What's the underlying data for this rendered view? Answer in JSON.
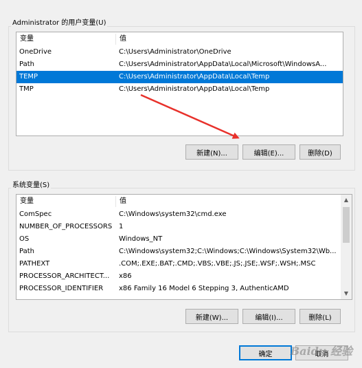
{
  "user_vars": {
    "group_title": "Administrator 的用户变量(U)",
    "headers": [
      "变量",
      "值"
    ],
    "rows": [
      {
        "name": "OneDrive",
        "value": "C:\\Users\\Administrator\\OneDrive"
      },
      {
        "name": "Path",
        "value": "C:\\Users\\Administrator\\AppData\\Local\\Microsoft\\WindowsA..."
      },
      {
        "name": "TEMP",
        "value": "C:\\Users\\Administrator\\AppData\\Local\\Temp"
      },
      {
        "name": "TMP",
        "value": "C:\\Users\\Administrator\\AppData\\Local\\Temp"
      }
    ],
    "selected_row": "TEMP",
    "buttons": {
      "new": "新建(N)...",
      "edit": "编辑(E)...",
      "delete": "删除(D)"
    }
  },
  "system_vars": {
    "group_title": "系统变量(S)",
    "headers": [
      "变量",
      "值"
    ],
    "rows": [
      {
        "name": "ComSpec",
        "value": "C:\\Windows\\system32\\cmd.exe"
      },
      {
        "name": "NUMBER_OF_PROCESSORS",
        "value": "1"
      },
      {
        "name": "OS",
        "value": "Windows_NT"
      },
      {
        "name": "Path",
        "value": "C:\\Windows\\system32;C:\\Windows;C:\\Windows\\System32\\Wb..."
      },
      {
        "name": "PATHEXT",
        "value": ".COM;.EXE;.BAT;.CMD;.VBS;.VBE;.JS;.JSE;.WSF;.WSH;.MSC"
      },
      {
        "name": "PROCESSOR_ARCHITECT...",
        "value": "x86"
      },
      {
        "name": "PROCESSOR_IDENTIFIER",
        "value": "x86 Family 16 Model 6 Stepping 3, AuthenticAMD"
      }
    ],
    "buttons": {
      "new": "新建(W)...",
      "edit": "编辑(I)...",
      "delete": "删除(L)"
    }
  },
  "dialog_buttons": {
    "ok": "确定",
    "cancel": "取消"
  },
  "annotation_color": "#e8312b",
  "watermark": "Baidu 经验"
}
